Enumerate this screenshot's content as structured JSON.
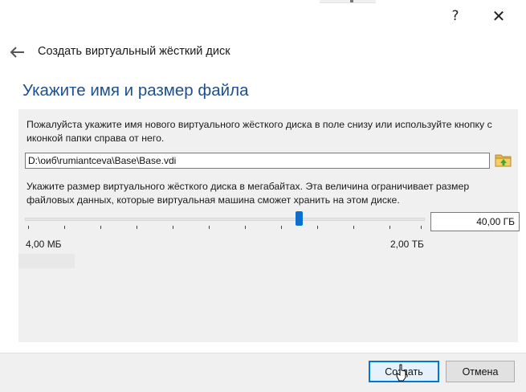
{
  "window": {
    "help_label": "?",
    "close_label": "✕"
  },
  "header": {
    "back_icon": "back-arrow-icon",
    "title": "Создать виртуальный жёсткий диск"
  },
  "page": {
    "heading": "Укажите имя и размер файла",
    "location_description": "Пожалуйста укажите имя нового виртуального жёсткого диска в поле снизу или используйте кнопку с иконкой папки справа от него.",
    "file_path": "D:\\оиб\\rumiantceva\\Base\\Base.vdi",
    "folder_icon": "folder-icon",
    "size_description": "Укажите размер виртуального жёсткого диска в мегабайтах. Эта величина ограничивает размер файловых данных, которые виртуальная машина сможет хранить на этом диске.",
    "size_value": "40,00 ГБ",
    "slider_position_fraction": 0.69,
    "min_label": "4,00 МБ",
    "max_label": "2,00 ТБ"
  },
  "buttons": {
    "create": "Создать",
    "cancel": "Отмена"
  },
  "colors": {
    "heading": "#1e4f8f",
    "accent": "#0078d7",
    "slider_thumb": "#0b6fcf"
  }
}
